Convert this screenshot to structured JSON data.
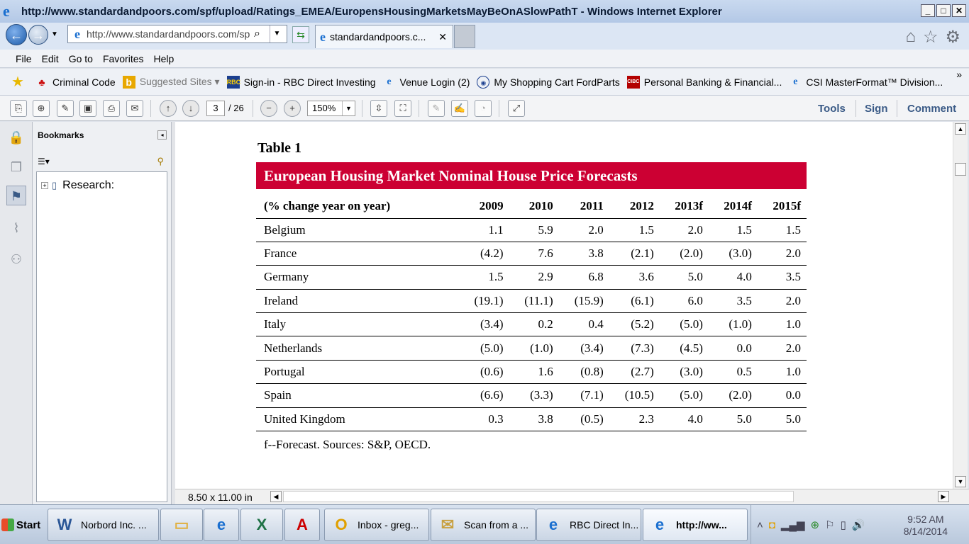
{
  "window": {
    "title": "http://www.standardandpoors.com/spf/upload/Ratings_EMEA/EuropensHousingMarketsMayBeOnASlowPathT - Windows Internet Explorer"
  },
  "addressbar": {
    "url": "http://www.standardandpoors.com/sp",
    "tab_label": "standardandpoors.c..."
  },
  "menu": [
    "File",
    "Edit",
    "Go to",
    "Favorites",
    "Help"
  ],
  "favorites": [
    {
      "label": "Criminal Code",
      "icon": "maple-leaf-icon",
      "color": "#cc1111",
      "dim": false
    },
    {
      "label": "Suggested Sites ▾",
      "icon": "bing-icon",
      "color": "#e8a800",
      "dim": true
    },
    {
      "label": "Sign-in - RBC Direct Investing",
      "icon": "rbc-icon",
      "color": "#1b3f8f",
      "dim": false
    },
    {
      "label": "Venue Login (2)",
      "icon": "ie-page-icon",
      "color": "#1a6fd0",
      "dim": false
    },
    {
      "label": "My Shopping Cart  FordParts",
      "icon": "ford-icon",
      "color": "#1b3f8f",
      "dim": false
    },
    {
      "label": "Personal Banking & Financial...",
      "icon": "cibc-icon",
      "color": "#b30000",
      "dim": false
    },
    {
      "label": "CSI MasterFormat™ Division...",
      "icon": "ie-page-icon",
      "color": "#1a6fd0",
      "dim": false
    }
  ],
  "pdf": {
    "page_current": "3",
    "page_total": "/ 26",
    "zoom": "150%",
    "tools": "Tools",
    "sign": "Sign",
    "comment": "Comment",
    "page_size": "8.50 x 11.00 in"
  },
  "bookmarks": {
    "header": "Bookmarks",
    "items": [
      "Research:"
    ]
  },
  "document": {
    "table_label": "Table 1",
    "table_title": "European Housing Market Nominal House Price Forecasts",
    "columns": [
      "(% change year on year)",
      "2009",
      "2010",
      "2011",
      "2012",
      "2013f",
      "2014f",
      "2015f"
    ],
    "rows": [
      [
        "Belgium",
        "1.1",
        "5.9",
        "2.0",
        "1.5",
        "2.0",
        "1.5",
        "1.5"
      ],
      [
        "France",
        "(4.2)",
        "7.6",
        "3.8",
        "(2.1)",
        "(2.0)",
        "(3.0)",
        "2.0"
      ],
      [
        "Germany",
        "1.5",
        "2.9",
        "6.8",
        "3.6",
        "5.0",
        "4.0",
        "3.5"
      ],
      [
        "Ireland",
        "(19.1)",
        "(11.1)",
        "(15.9)",
        "(6.1)",
        "6.0",
        "3.5",
        "2.0"
      ],
      [
        "Italy",
        "(3.4)",
        "0.2",
        "0.4",
        "(5.2)",
        "(5.0)",
        "(1.0)",
        "1.0"
      ],
      [
        "Netherlands",
        "(5.0)",
        "(1.0)",
        "(3.4)",
        "(7.3)",
        "(4.5)",
        "0.0",
        "2.0"
      ],
      [
        "Portugal",
        "(0.6)",
        "1.6",
        "(0.8)",
        "(2.7)",
        "(3.0)",
        "0.5",
        "1.0"
      ],
      [
        "Spain",
        "(6.6)",
        "(3.3)",
        "(7.1)",
        "(10.5)",
        "(5.0)",
        "(2.0)",
        "0.0"
      ],
      [
        "United Kingdom",
        "0.3",
        "3.8",
        "(0.5)",
        "2.3",
        "4.0",
        "5.0",
        "5.0"
      ]
    ],
    "footnote": "f--Forecast. Sources: S&P, OECD.",
    "banner_color": "#cc0033"
  },
  "taskbar": {
    "start": "Start",
    "buttons": [
      {
        "label": "Norbord Inc. ...",
        "icon": "word-icon",
        "glyph": "W",
        "color": "#2b5797"
      },
      {
        "label": "",
        "icon": "folder-icon",
        "glyph": "▭",
        "color": "#e0b040"
      },
      {
        "label": "",
        "icon": "ie-icon",
        "glyph": "e",
        "color": "#1a6fd0"
      },
      {
        "label": "",
        "icon": "excel-icon",
        "glyph": "X",
        "color": "#1e7145"
      },
      {
        "label": "",
        "icon": "acrobat-icon",
        "glyph": "A",
        "color": "#cc0000"
      },
      {
        "label": "Inbox - greg...",
        "icon": "outlook-icon",
        "glyph": "O",
        "color": "#e0a000"
      },
      {
        "label": "Scan from a ...",
        "icon": "envelope-icon",
        "glyph": "✉",
        "color": "#c8a040"
      },
      {
        "label": "RBC Direct In...",
        "icon": "ie-icon",
        "glyph": "e",
        "color": "#1a6fd0"
      },
      {
        "label": "http://ww...",
        "icon": "ie-icon",
        "glyph": "e",
        "color": "#1a6fd0"
      }
    ],
    "clock_time": "9:52 AM",
    "clock_date": "8/14/2014"
  }
}
